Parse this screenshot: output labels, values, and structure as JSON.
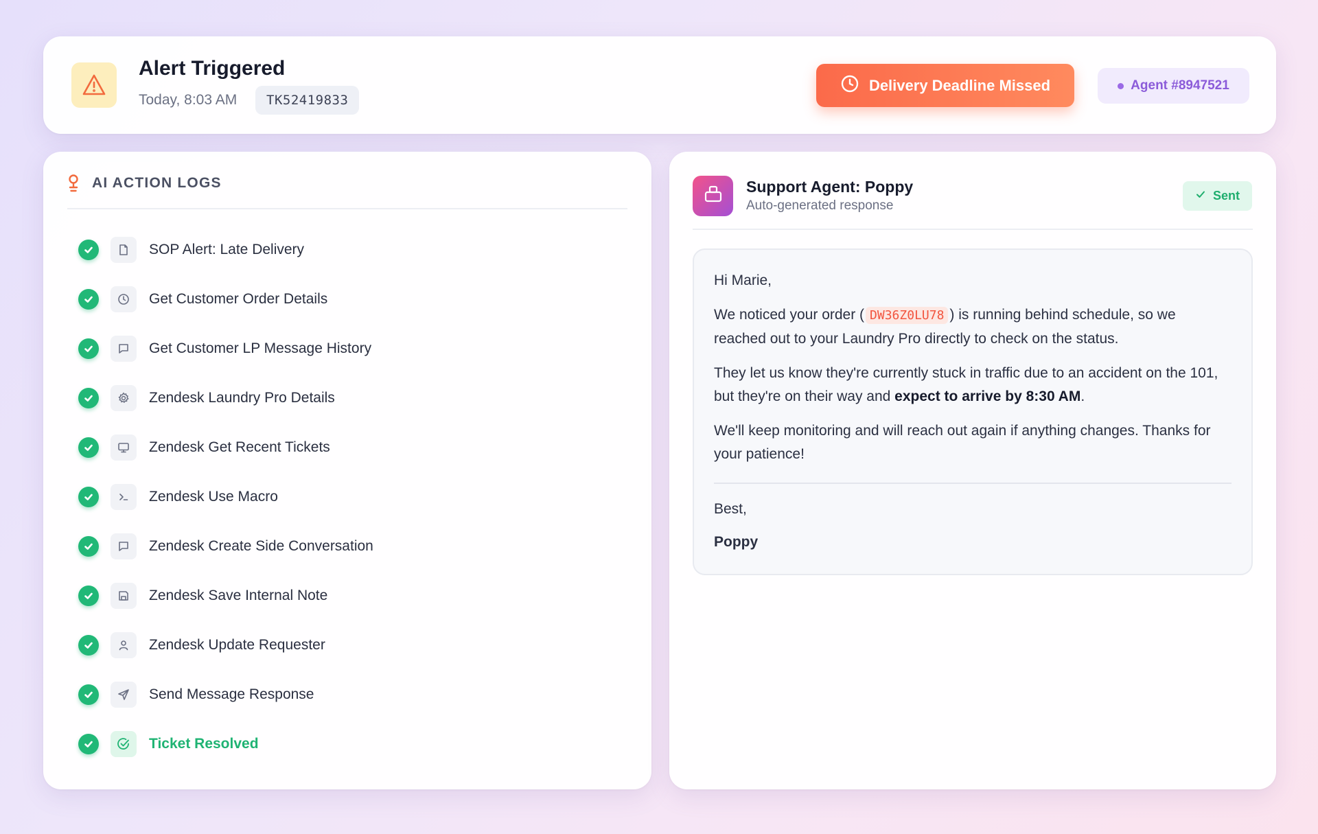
{
  "header": {
    "title": "Alert Triggered",
    "time": "Today, 8:03 AM",
    "ticket_id": "TK52419833",
    "deadline_label": "Delivery Deadline Missed",
    "agent_label": "Agent #8947521"
  },
  "logs": {
    "title": "AI ACTION LOGS",
    "items": [
      {
        "label": "SOP Alert: Late Delivery",
        "icon": "file-icon"
      },
      {
        "label": "Get Customer Order Details",
        "icon": "clock-icon"
      },
      {
        "label": "Get Customer LP Message History",
        "icon": "message-icon"
      },
      {
        "label": "Zendesk Laundry Pro Details",
        "icon": "gear-icon"
      },
      {
        "label": "Zendesk Get Recent Tickets",
        "icon": "monitor-icon"
      },
      {
        "label": "Zendesk Use Macro",
        "icon": "terminal-icon"
      },
      {
        "label": "Zendesk Create Side Conversation",
        "icon": "message-icon"
      },
      {
        "label": "Zendesk Save Internal Note",
        "icon": "save-icon"
      },
      {
        "label": "Zendesk Update Requester",
        "icon": "user-icon"
      },
      {
        "label": "Send Message Response",
        "icon": "send-icon"
      },
      {
        "label": "Ticket Resolved",
        "icon": "check-circle-icon"
      }
    ]
  },
  "response": {
    "agent_name": "Support Agent: Poppy",
    "subtitle": "Auto-generated response",
    "status": "Sent",
    "greeting": "Hi Marie,",
    "p1_before": "We noticed your order (",
    "order_code": "DW36Z0LU78",
    "p1_after": ") is running behind schedule, so we reached out to your Laundry Pro directly to check on the status.",
    "p2_before": "They let us know they're currently stuck in traffic due to an accident on the 101, but they're on their way and ",
    "p2_bold": "expect to arrive by 8:30 AM",
    "p2_after": ".",
    "p3": "We'll keep monitoring and will reach out again if anything changes. Thanks for your patience!",
    "closing": "Best,",
    "signature": "Poppy"
  },
  "colors": {
    "accent_orange": "#fb6a4a",
    "success_green": "#21b877",
    "agent_purple": "#8b5bd9"
  }
}
